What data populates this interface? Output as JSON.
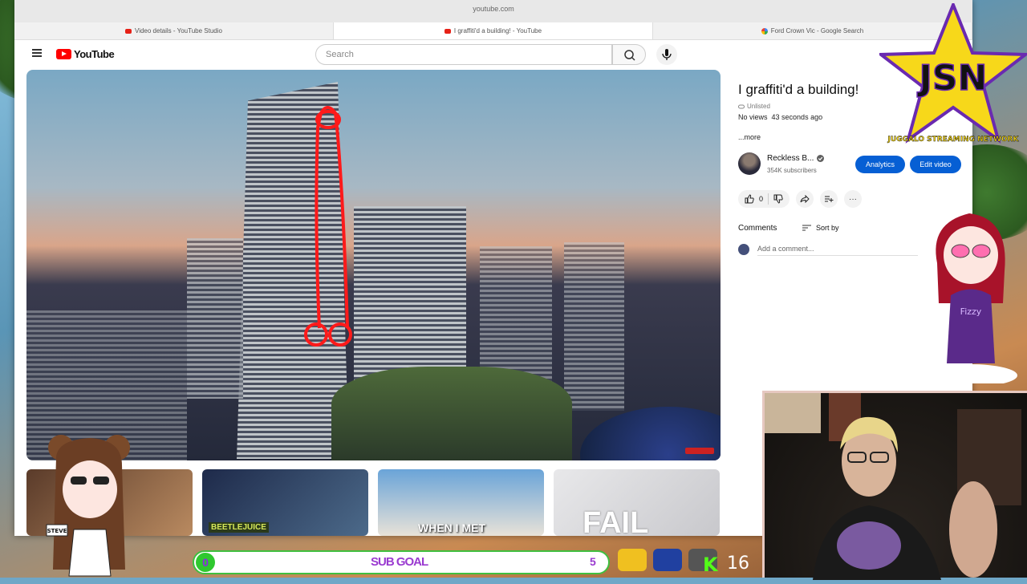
{
  "browser": {
    "url": "youtube.com",
    "tabs": [
      {
        "label": "Video details - YouTube Studio",
        "active": false
      },
      {
        "label": "I graffiti'd a building! - YouTube",
        "active": true
      },
      {
        "label": "Ford Crown Vic - Google Search",
        "active": false
      }
    ]
  },
  "youtube": {
    "logo_text": "YouTube",
    "search_placeholder": "Search"
  },
  "video": {
    "title": "I graffiti'd a building!",
    "visibility": "Unlisted",
    "views": "No views",
    "age": "43 seconds ago",
    "more": "...more",
    "channel_name": "Reckless B...",
    "subscribers": "354K subscribers",
    "analytics_label": "Analytics",
    "edit_label": "Edit video",
    "likes": "0",
    "comments_label": "Comments",
    "sort_label": "Sort by",
    "add_comment_placeholder": "Add a comment..."
  },
  "thumbnails": [
    {
      "caption": "",
      "colors": [
        "#5a3b2a",
        "#b98a60"
      ]
    },
    {
      "caption": "BEETLEJUICE",
      "colors": [
        "#1e2a4a",
        "#4c6a8a"
      ]
    },
    {
      "caption": "WHEN I MET",
      "colors": [
        "#6aa4d8",
        "#e8e2d8"
      ]
    },
    {
      "caption": "FAIL",
      "colors": [
        "#e8e8ea",
        "#c8c8cc"
      ]
    }
  ],
  "overlay": {
    "logo_text": "JSN",
    "logo_subtext": "JUGGALO STREAMING NETWORK",
    "vtuber_shirt": "Fizzy",
    "sub_goal_label": "SUB GOAL",
    "sub_goal_current": "0",
    "sub_goal_target": "5",
    "kick_icon": "K",
    "viewer_count": "16",
    "sign_text": "STEVE"
  },
  "colors": {
    "accent_blue": "#065fd4",
    "yt_red": "#ff0000",
    "kick_green": "#53fc18",
    "goal_purple": "#9a3ad0"
  }
}
